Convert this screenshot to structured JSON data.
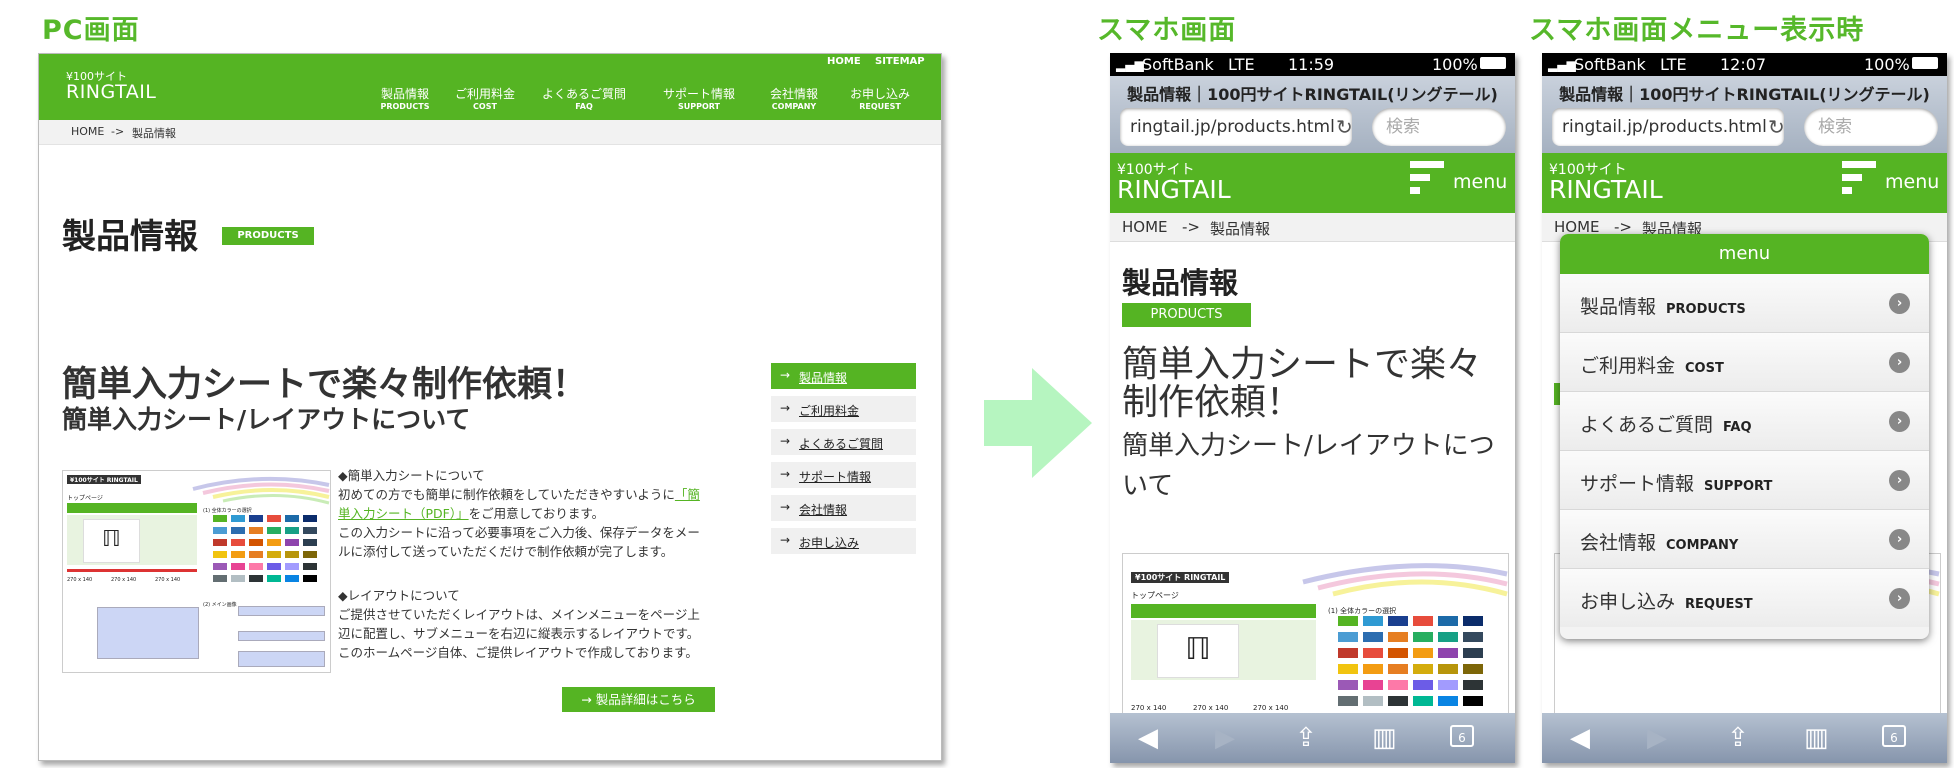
{
  "section_titles": {
    "pc": "PC画面",
    "sp": "スマホ画面",
    "sp_menu": "スマホ画面メニュー表示時"
  },
  "brand": {
    "small": "¥100サイト",
    "big": "RINGTAIL"
  },
  "pc": {
    "util_links": [
      "HOME",
      "SITEMAP"
    ],
    "nav": [
      {
        "ja": "製品情報",
        "en": "PRODUCTS"
      },
      {
        "ja": "ご利用料金",
        "en": "COST"
      },
      {
        "ja": "よくあるご質問",
        "en": "FAQ"
      },
      {
        "ja": "サポート情報",
        "en": "SUPPORT"
      },
      {
        "ja": "会社情報",
        "en": "COMPANY"
      },
      {
        "ja": "お申し込み",
        "en": "REQUEST"
      }
    ],
    "breadcrumb": {
      "home": "HOME",
      "sep": "->",
      "current": "製品情報"
    },
    "h1": "製品情報",
    "badge": "PRODUCTS",
    "h2": "簡単入力シートで楽々制作依頼！",
    "h2_sub": "簡単入力シート/レイアウトについて",
    "side_menu": [
      "製品情報",
      "ご利用料金",
      "よくあるご質問",
      "サポート情報",
      "会社情報",
      "お申し込み"
    ],
    "text": {
      "p1_title": "◆簡単入力シートについて",
      "p1_l1a": "初めての方でも簡単に制作依頼をしていただきやすいように",
      "p1_l1b": "「簡",
      "p1_l2a": "単入力シート（PDF）」",
      "p1_l2b": "をご用意しております。",
      "p1_l3": "この入力シートに沿って必要事項をご入力後、保存データをメー",
      "p1_l4": "ルに添付して送っていただくだけで制作依頼が完了します。",
      "p2_title": "◆レイアウトについて",
      "p2_l1": "ご提供させていただくレイアウトは、メインメニューをページ上",
      "p2_l2": "辺に配置し、サブメニューを右辺に縦表示するレイアウトです。",
      "p2_l3": "このホームページ自体、ご提供レイアウトで作成しております。"
    },
    "detail_button": "製品詳細はこちら"
  },
  "thumb": {
    "brand": "¥100サイト RINGTAIL",
    "page": "トップページ",
    "section1": "(1) 全体カラーの選択",
    "section2": "(2) メイン画像",
    "size": "270 x 140"
  },
  "sp": {
    "status_carrier": "SoftBank",
    "status_net": "LTE",
    "status_battery": "100%",
    "time_1": "11:59",
    "time_2": "12:07",
    "page_title": "製品情報｜100円サイトRINGTAIL(リングテール)",
    "url": "ringtail.jp/products.html",
    "search_placeholder": "検索",
    "menu_label": "menu",
    "h2": "簡単入力シートで楽々制作依頼！",
    "h2_sub": "簡単入力シート/レイアウトについて",
    "tab_count": "6"
  },
  "menu_overlay": {
    "header": "menu",
    "items": [
      {
        "ja": "製品情報",
        "en": "PRODUCTS"
      },
      {
        "ja": "ご利用料金",
        "en": "COST"
      },
      {
        "ja": "よくあるご質問",
        "en": "FAQ"
      },
      {
        "ja": "サポート情報",
        "en": "SUPPORT"
      },
      {
        "ja": "会社情報",
        "en": "COMPANY"
      },
      {
        "ja": "お申し込み",
        "en": "REQUEST"
      }
    ]
  },
  "colors": {
    "accent": "#55b423",
    "arrow": "#b6f5c0"
  },
  "icons": [
    "signal-icon",
    "battery-icon",
    "reload-icon",
    "hamburger-icon",
    "back-icon",
    "forward-icon",
    "share-icon",
    "bookmarks-icon",
    "tabs-icon",
    "chevron-right-icon",
    "arrow-right-icon"
  ]
}
